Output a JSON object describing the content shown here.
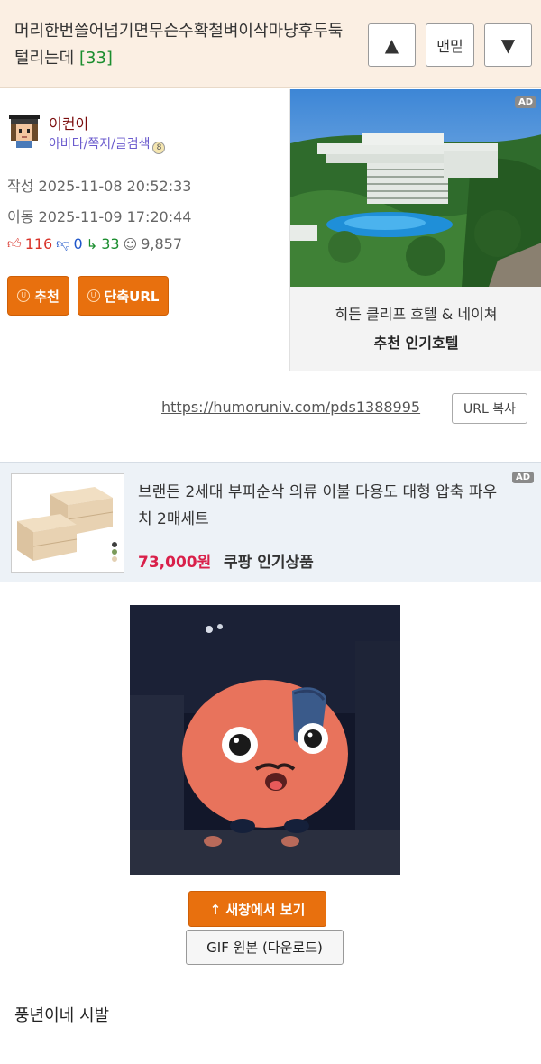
{
  "header": {
    "title": "머리한번쓸어넘기면무슨수확철벼이삭마냥후두둑털리는데",
    "comment_count": "[33]",
    "up_label": "▲",
    "bottom_label": "맨밑",
    "down_label": "▼"
  },
  "author": {
    "nickname": "이컨이",
    "links": "아바타/쪽지/글검색",
    "written_label": "작성",
    "written": "2025-11-08 20:52:33",
    "moved_label": "이동",
    "moved": "2025-11-09 17:20:44",
    "stats": {
      "up": "116",
      "down": "0",
      "share": "33",
      "views": "9,857"
    },
    "recommend_button": "추천",
    "short_url_button": "단축URL"
  },
  "side_ad": {
    "badge": "AD",
    "name": "히든 클리프 호텔 & 네이쳐",
    "sub": "추천 인기호텔"
  },
  "url_row": {
    "url": "https://humoruniv.com/pds1388995",
    "copy_button": "URL 복사"
  },
  "product_ad": {
    "badge": "AD",
    "title": "브랜든 2세대 부피순삭 의류 이불 다용도 대형 압축 파우치 2매세트",
    "price": "73,000원",
    "store": "쿠팡 인기상품"
  },
  "media": {
    "new_window_button": "↑ 새창에서 보기",
    "gif_download_button": "GIF 원본 (다운로드)"
  },
  "post": {
    "text": "풍년이네 시발"
  },
  "colors": {
    "accent_orange": "#e8700e",
    "header_bg": "#fbefe3",
    "up_red": "#d9342b",
    "down_blue": "#1e55c9",
    "share_green": "#1a8d2e",
    "price_red": "#d9204a"
  }
}
